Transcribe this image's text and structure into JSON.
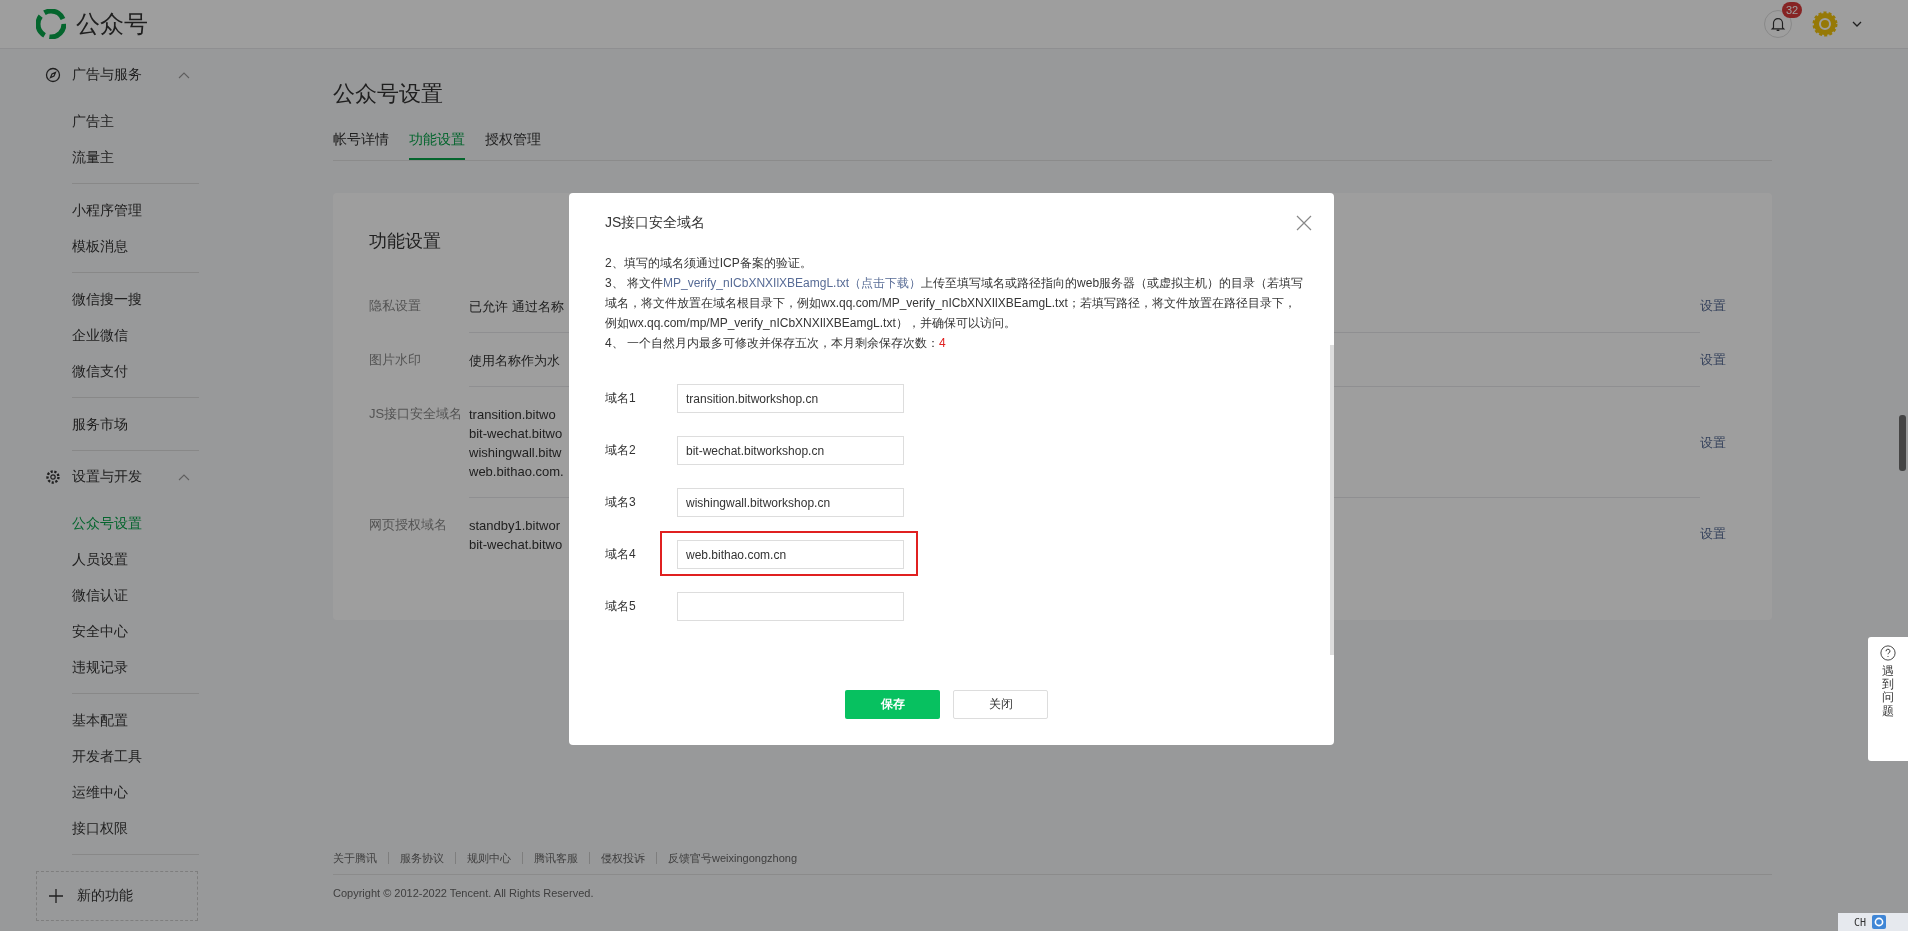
{
  "header": {
    "logo_text": "公众号",
    "notification_count": "32"
  },
  "sidebar": {
    "sections": [
      {
        "title": "广告与服务",
        "expanded": true,
        "groups": [
          [
            {
              "label": "广告主",
              "selected": false
            },
            {
              "label": "流量主",
              "selected": false
            }
          ],
          [
            {
              "label": "小程序管理",
              "selected": false
            },
            {
              "label": "模板消息",
              "selected": false
            }
          ],
          [
            {
              "label": "微信搜一搜",
              "selected": false
            },
            {
              "label": "企业微信",
              "selected": false
            },
            {
              "label": "微信支付",
              "selected": false
            }
          ],
          [
            {
              "label": "服务市场",
              "selected": false
            }
          ]
        ]
      },
      {
        "title": "设置与开发",
        "expanded": true,
        "groups": [
          [
            {
              "label": "公众号设置",
              "selected": true
            },
            {
              "label": "人员设置",
              "selected": false
            },
            {
              "label": "微信认证",
              "selected": false
            },
            {
              "label": "安全中心",
              "selected": false
            },
            {
              "label": "违规记录",
              "selected": false
            }
          ],
          [
            {
              "label": "基本配置",
              "selected": false
            },
            {
              "label": "开发者工具",
              "selected": false
            },
            {
              "label": "运维中心",
              "selected": false
            },
            {
              "label": "接口权限",
              "selected": false
            }
          ]
        ]
      }
    ],
    "new_feature": "新的功能"
  },
  "page": {
    "title": "公众号设置",
    "tabs": [
      {
        "label": "帐号详情",
        "selected": false
      },
      {
        "label": "功能设置",
        "selected": true
      },
      {
        "label": "授权管理",
        "selected": false
      }
    ]
  },
  "card": {
    "title": "功能设置",
    "rows": [
      {
        "label": "隐私设置",
        "values": [
          "已允许 通过名称"
        ],
        "action": "设置"
      },
      {
        "label": "图片水印",
        "values": [
          "使用名称作为水"
        ],
        "action": "设置"
      },
      {
        "label": "JS接口安全域名",
        "values": [
          "transition.bitwo",
          "bit-wechat.bitwo",
          "wishingwall.bitw",
          "web.bithao.com."
        ],
        "action": "设置"
      },
      {
        "label": "网页授权域名",
        "values": [
          "standby1.bitwor",
          "bit-wechat.bitwo"
        ],
        "action": "设置"
      }
    ]
  },
  "modal": {
    "title": "JS接口安全域名",
    "notes": [
      {
        "text": "2、填写的域名须通过ICP备案的验证。"
      },
      {
        "text": "3、 将文件",
        "link": "MP_verify_nICbXNXIlXBEamgL.txt（点击下载）",
        "after": "上传至填写域名或路径指向的web服务器（或虚拟主机）的目录（若填写域名，将文件放置在域名根目录下，例如wx.qq.com/MP_verify_nICbXNXIlXBEamgL.txt；若填写路径，将文件放置在路径目录下，例如wx.qq.com/mp/MP_verify_nICbXNXIlXBEamgL.txt），并确保可以访问。"
      },
      {
        "text": "4、 一个自然月内最多可修改并保存五次，本月剩余保存次数：",
        "count": "4"
      }
    ],
    "fields": [
      {
        "label": "域名1",
        "value": "transition.bitworkshop.cn",
        "highlighted": false
      },
      {
        "label": "域名2",
        "value": "bit-wechat.bitworkshop.cn",
        "highlighted": false
      },
      {
        "label": "域名3",
        "value": "wishingwall.bitworkshop.cn",
        "highlighted": false
      },
      {
        "label": "域名4",
        "value": "web.bithao.com.cn",
        "highlighted": true
      },
      {
        "label": "域名5",
        "highlighted": false
      }
    ],
    "save": "保存",
    "close": "关闭"
  },
  "footer": {
    "links": [
      "关于腾讯",
      "服务协议",
      "规则中心",
      "腾讯客服",
      "侵权投诉",
      "反馈官号weixingongzhong"
    ],
    "copyright": "Copyright © 2012-2022 Tencent. All Rights Reserved."
  },
  "help": {
    "text": "遇到问题"
  },
  "taskbar": {
    "ime": "CH"
  }
}
